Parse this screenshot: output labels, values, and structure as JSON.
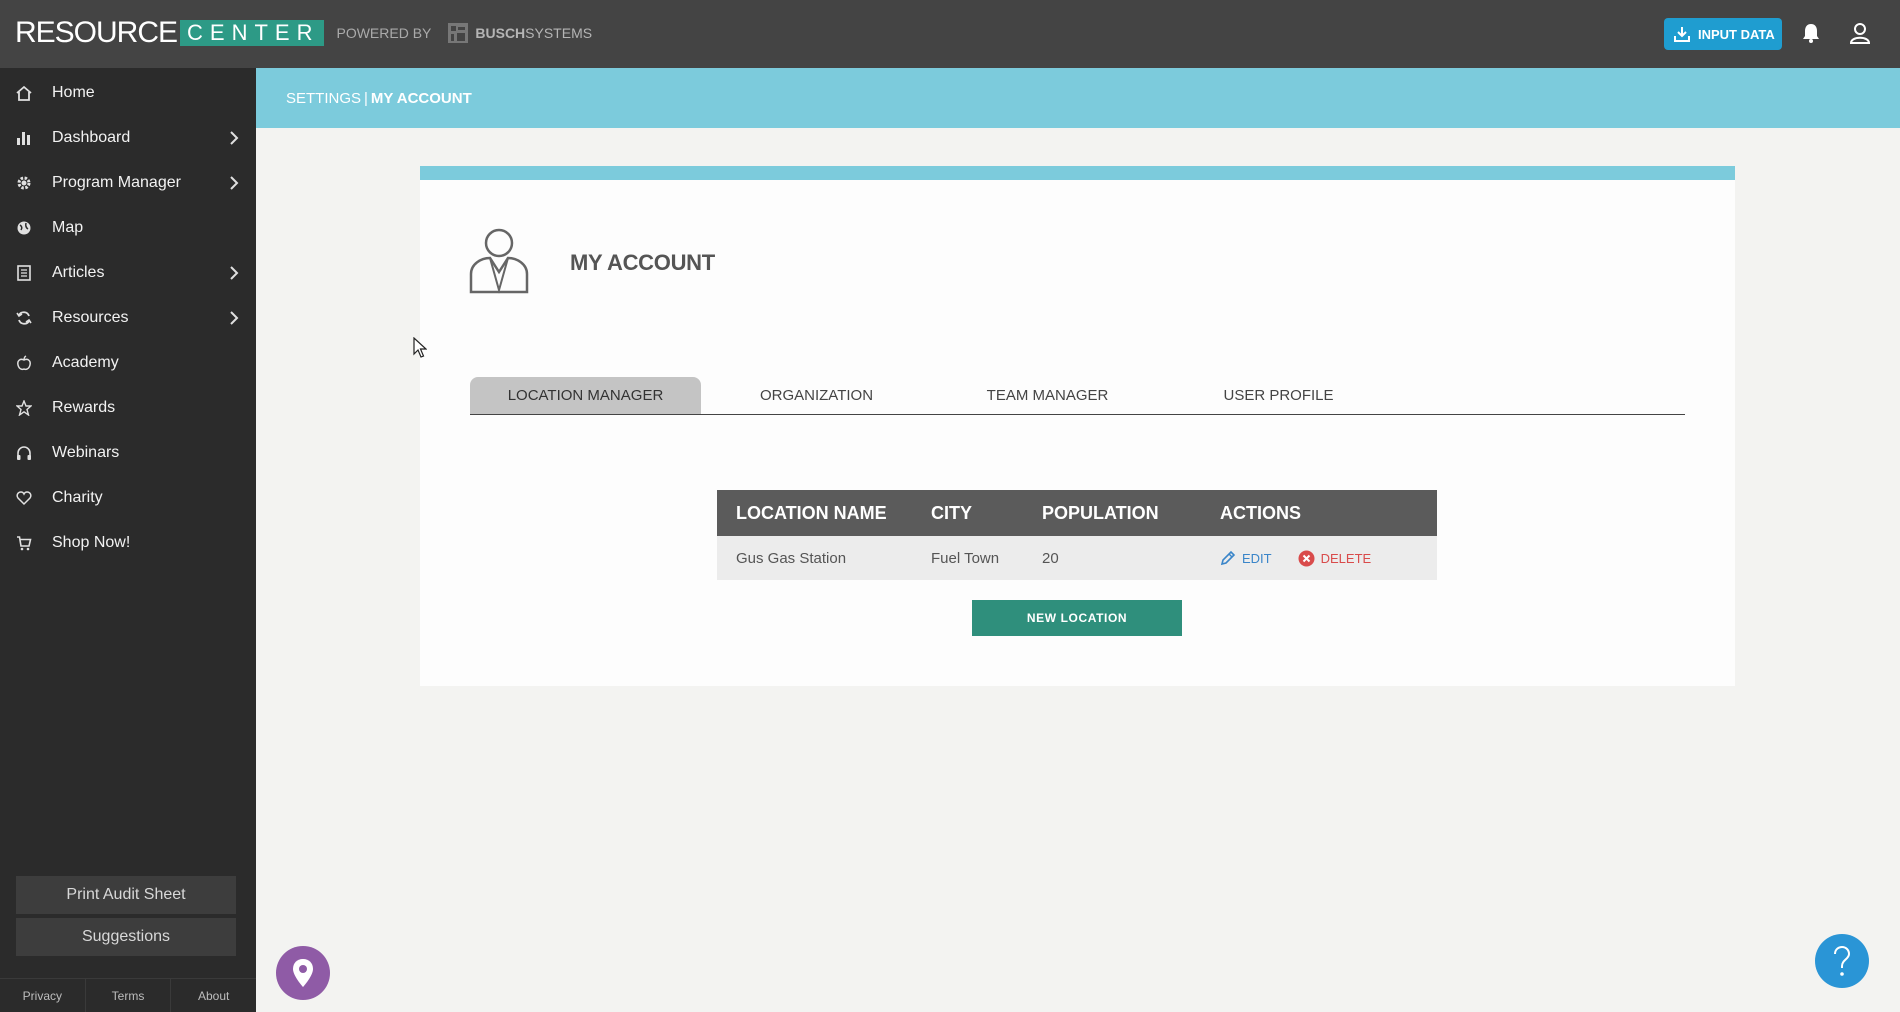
{
  "brand": {
    "name_part1": "RESOURCE",
    "name_part2": "CENTER",
    "powered_by": "POWERED BY",
    "partner_bold": "BUSCH",
    "partner_rest": "SYSTEMS"
  },
  "header": {
    "input_data_label": "INPUT DATA",
    "bell_icon": "bell-icon",
    "user_icon": "user-icon"
  },
  "sidebar": {
    "items": [
      {
        "label": "Home",
        "icon": "home-icon",
        "has_submenu": false
      },
      {
        "label": "Dashboard",
        "icon": "bar-chart-icon",
        "has_submenu": true
      },
      {
        "label": "Program Manager",
        "icon": "gear-icon",
        "has_submenu": true
      },
      {
        "label": "Map",
        "icon": "globe-icon",
        "has_submenu": false
      },
      {
        "label": "Articles",
        "icon": "document-icon",
        "has_submenu": true
      },
      {
        "label": "Resources",
        "icon": "refresh-icon",
        "has_submenu": true
      },
      {
        "label": "Academy",
        "icon": "apple-icon",
        "has_submenu": false
      },
      {
        "label": "Rewards",
        "icon": "star-icon",
        "has_submenu": false
      },
      {
        "label": "Webinars",
        "icon": "headphones-icon",
        "has_submenu": false
      },
      {
        "label": "Charity",
        "icon": "heart-icon",
        "has_submenu": false
      },
      {
        "label": "Shop Now!",
        "icon": "cart-icon",
        "has_submenu": false
      }
    ],
    "print_audit_label": "Print Audit Sheet",
    "suggestions_label": "Suggestions",
    "footer": {
      "privacy": "Privacy",
      "terms": "Terms",
      "about": "About"
    }
  },
  "breadcrumb": {
    "settings": "SETTINGS",
    "separator": "|",
    "current": "MY ACCOUNT"
  },
  "account": {
    "title": "MY ACCOUNT",
    "tabs": [
      {
        "label": "LOCATION MANAGER",
        "active": true
      },
      {
        "label": "ORGANIZATION",
        "active": false
      },
      {
        "label": "TEAM MANAGER",
        "active": false
      },
      {
        "label": "USER PROFILE",
        "active": false
      }
    ]
  },
  "locations_table": {
    "headers": [
      "LOCATION NAME",
      "CITY",
      "POPULATION",
      "ACTIONS"
    ],
    "rows": [
      {
        "name": "Gus Gas Station",
        "city": "Fuel Town",
        "population": "20",
        "edit_label": "EDIT",
        "delete_label": "DELETE"
      }
    ],
    "new_location_label": "NEW LOCATION"
  },
  "colors": {
    "topbar": "#444444",
    "sidebar": "#2b2b2b",
    "accent_teal": "#7ccbdc",
    "brand_green": "#2d9a86",
    "button_green": "#2f8f7c",
    "input_data_blue": "#1f9dd0",
    "help_blue": "#2a95d6",
    "map_pin_purple": "#8f5ba6"
  },
  "floating": {
    "map_pin_icon": "map-pin-icon",
    "help_icon": "question-mark-icon"
  }
}
